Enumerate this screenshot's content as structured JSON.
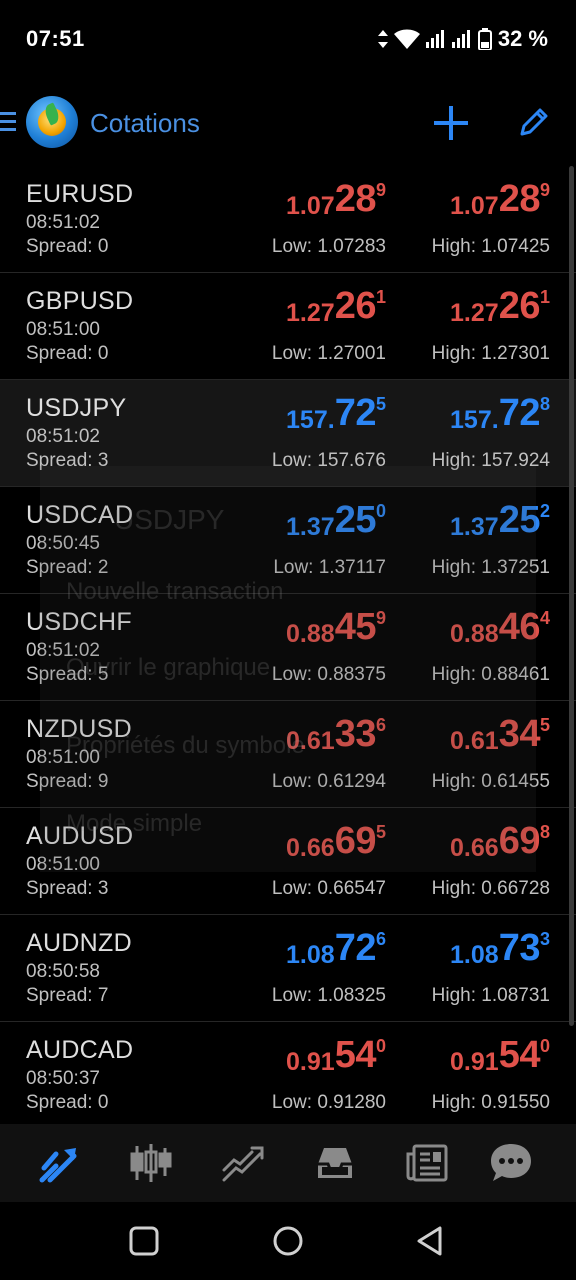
{
  "status": {
    "time": "07:51",
    "battery": "32 %"
  },
  "toolbar": {
    "title": "Cotations"
  },
  "rows": [
    {
      "symbol": "EURUSD",
      "time": "08:51:02",
      "spread": "Spread: 0",
      "color": "#e0524b",
      "bid": [
        "1.07",
        "28",
        "9"
      ],
      "ask": [
        "1.07",
        "28",
        "9"
      ],
      "low": "Low: 1.07283",
      "high": "High: 1.07425"
    },
    {
      "symbol": "GBPUSD",
      "time": "08:51:00",
      "spread": "Spread: 0",
      "color": "#e0524b",
      "bid": [
        "1.27",
        "26",
        "1"
      ],
      "ask": [
        "1.27",
        "26",
        "1"
      ],
      "low": "Low: 1.27001",
      "high": "High: 1.27301"
    },
    {
      "symbol": "USDJPY",
      "time": "08:51:02",
      "spread": "Spread: 3",
      "color": "#2c86f5",
      "bid": [
        "157.",
        "72",
        "5"
      ],
      "ask": [
        "157.",
        "72",
        "8"
      ],
      "low": "Low: 157.676",
      "high": "High: 157.924"
    },
    {
      "symbol": "USDCAD",
      "time": "08:50:45",
      "spread": "Spread: 2",
      "color": "#2c86f5",
      "bid": [
        "1.37",
        "25",
        "0"
      ],
      "ask": [
        "1.37",
        "25",
        "2"
      ],
      "low": "Low: 1.37117",
      "high": "High: 1.37251"
    },
    {
      "symbol": "USDCHF",
      "time": "08:51:02",
      "spread": "Spread: 5",
      "color": "#e0524b",
      "bid": [
        "0.88",
        "45",
        "9"
      ],
      "ask": [
        "0.88",
        "46",
        "4"
      ],
      "low": "Low: 0.88375",
      "high": "High: 0.88461"
    },
    {
      "symbol": "NZDUSD",
      "time": "08:51:00",
      "spread": "Spread: 9",
      "color": "#e0524b",
      "bid": [
        "0.61",
        "33",
        "6"
      ],
      "ask": [
        "0.61",
        "34",
        "5"
      ],
      "low": "Low: 0.61294",
      "high": "High: 0.61455"
    },
    {
      "symbol": "AUDUSD",
      "time": "08:51:00",
      "spread": "Spread: 3",
      "color": "#e0524b",
      "bid": [
        "0.66",
        "69",
        "5"
      ],
      "ask": [
        "0.66",
        "69",
        "8"
      ],
      "low": "Low: 0.66547",
      "high": "High: 0.66728"
    },
    {
      "symbol": "AUDNZD",
      "time": "08:50:58",
      "spread": "Spread: 7",
      "color": "#2c86f5",
      "bid": [
        "1.08",
        "72",
        "6"
      ],
      "ask": [
        "1.08",
        "73",
        "3"
      ],
      "low": "Low: 1.08325",
      "high": "High: 1.08731"
    },
    {
      "symbol": "AUDCAD",
      "time": "08:50:37",
      "spread": "Spread: 0",
      "color": "#e0524b",
      "bid": [
        "0.91",
        "54",
        "0"
      ],
      "ask": [
        "0.91",
        "54",
        "0"
      ],
      "low": "Low: 0.91280",
      "high": "High: 0.91550"
    }
  ],
  "ghost_menu": {
    "title": "USDJPY",
    "items": [
      "Nouvelle transaction",
      "Ouvrir le graphique",
      "Propriétés du symbole",
      "Mode simple"
    ]
  },
  "bottom_nav": {
    "icons": [
      "quotes-icon",
      "chart-icon",
      "trade-icon",
      "history-icon",
      "news-icon",
      "chat-icon"
    ],
    "active_color": "#2c86f5",
    "inactive_color": "#8a8a8a"
  },
  "system_nav": {
    "icons": [
      "recents-icon",
      "home-icon",
      "back-icon"
    ]
  }
}
